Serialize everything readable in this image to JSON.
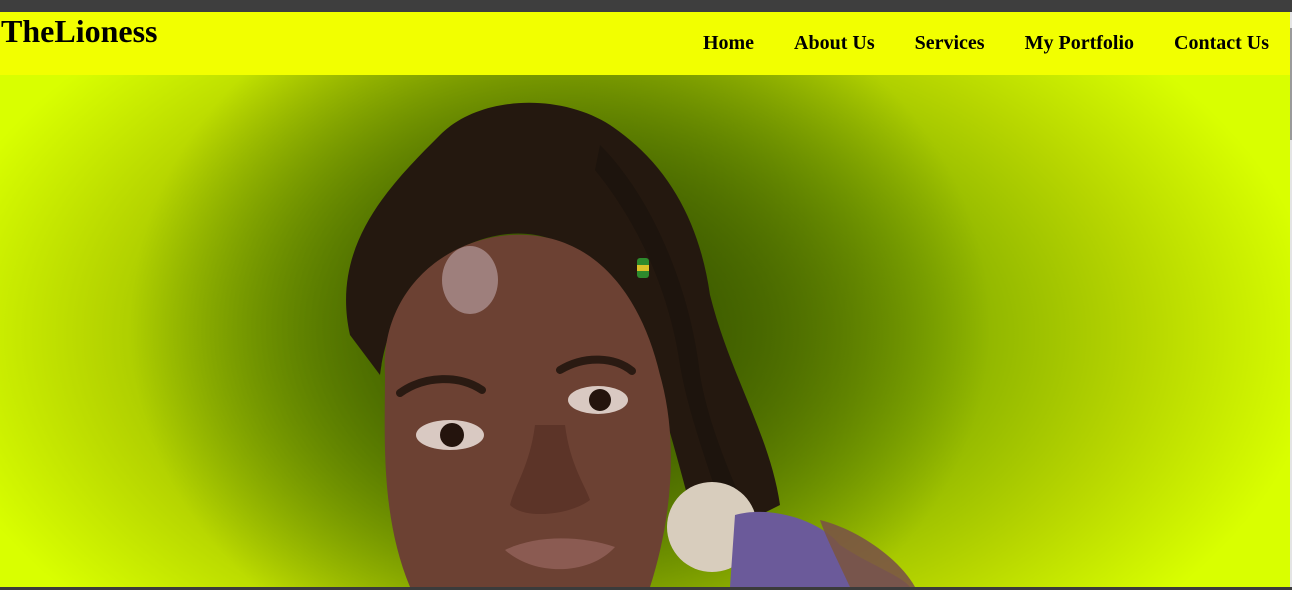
{
  "header": {
    "brand": "TheLioness",
    "nav": [
      {
        "label": "Home"
      },
      {
        "label": "About Us"
      },
      {
        "label": "Services"
      },
      {
        "label": "My Portfolio"
      },
      {
        "label": "Contact Us"
      }
    ]
  },
  "colors": {
    "header_background": "#f2ff00",
    "hero_outer": "#d9ff00",
    "hero_center": "#3f5c00",
    "text": "#000000"
  }
}
